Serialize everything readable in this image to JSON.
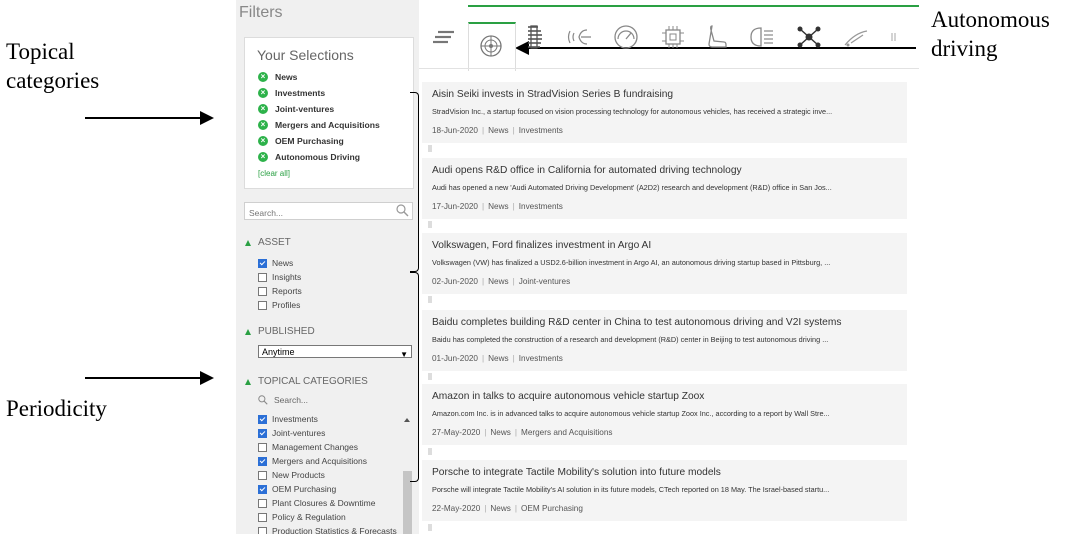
{
  "annotations": {
    "topical": "Topical\ncategories",
    "periodicity": "Periodicity",
    "autonomous": "Autonomous\ndriving"
  },
  "panel": {
    "title": "Filters",
    "your_selections": "Your Selections",
    "selections": [
      "News",
      "Investments",
      "Joint-ventures",
      "Mergers and Acquisitions",
      "OEM Purchasing",
      "Autonomous Driving"
    ],
    "clear_all": "[clear all]",
    "search_placeholder": "Search...",
    "asset": {
      "heading": "ASSET",
      "options": [
        {
          "label": "News",
          "checked": true
        },
        {
          "label": "Insights",
          "checked": false
        },
        {
          "label": "Reports",
          "checked": false
        },
        {
          "label": "Profiles",
          "checked": false
        }
      ]
    },
    "published": {
      "heading": "PUBLISHED",
      "selected": "Anytime"
    },
    "topical": {
      "heading": "TOPICAL CATEGORIES",
      "search_placeholder": "Search...",
      "options": [
        {
          "label": "Investments",
          "checked": true
        },
        {
          "label": "Joint-ventures",
          "checked": true
        },
        {
          "label": "Management Changes",
          "checked": false
        },
        {
          "label": "Mergers and Acquisitions",
          "checked": true
        },
        {
          "label": "New Products",
          "checked": false
        },
        {
          "label": "OEM Purchasing",
          "checked": true
        },
        {
          "label": "Plant Closures & Downtime",
          "checked": false
        },
        {
          "label": "Policy & Regulation",
          "checked": false
        },
        {
          "label": "Production Statistics & Forecasts",
          "checked": false
        }
      ]
    }
  },
  "toolbar": {
    "icons": [
      "menu-lines-icon",
      "autonomous-target-icon",
      "battery-grid-icon",
      "connectivity-wave-icon",
      "speedometer-icon",
      "chip-icon",
      "seat-icon",
      "headlight-icon",
      "network-nodes-icon",
      "wiper-icon"
    ],
    "accent": "#2aa043"
  },
  "articles": [
    {
      "title": "Aisin Seiki invests in StradVision Series B fundraising",
      "desc": "StradVision Inc., a startup focused on vision processing technology for autonomous vehicles, has received a strategic inve...",
      "date": "18-Jun-2020",
      "tags": [
        "News",
        "Investments"
      ]
    },
    {
      "title": "Audi opens R&D office in California for automated driving technology",
      "desc": "Audi has opened a new 'Audi Automated Driving Development' (A2D2) research and development (R&D) office in San Jos...",
      "date": "17-Jun-2020",
      "tags": [
        "News",
        "Investments"
      ]
    },
    {
      "title": "Volkswagen, Ford finalizes investment in Argo AI",
      "desc": "Volkswagen (VW) has finalized a USD2.6-billion investment in Argo AI, an autonomous driving startup based in Pittsburg, ...",
      "date": "02-Jun-2020",
      "tags": [
        "News",
        "Joint-ventures"
      ]
    },
    {
      "title": "Baidu completes building R&D center in China to test autonomous driving and V2I systems",
      "desc": "Baidu has completed the construction of a research and development (R&D) center in Beijing to test autonomous driving ...",
      "date": "01-Jun-2020",
      "tags": [
        "News",
        "Investments"
      ]
    },
    {
      "title": "Amazon in talks to acquire autonomous vehicle startup Zoox",
      "desc": "Amazon.com Inc. is in advanced talks to acquire autonomous vehicle startup Zoox Inc., according to a report by Wall Stre...",
      "date": "27-May-2020",
      "tags": [
        "News",
        "Mergers and Acquisitions"
      ]
    },
    {
      "title": "Porsche to integrate Tactile Mobility's solution into future models",
      "desc": "Porsche will integrate Tactile Mobility's AI solution in its future models, CTech reported on 18 May. The Israel-based startu...",
      "date": "22-May-2020",
      "tags": [
        "News",
        "OEM Purchasing"
      ]
    }
  ]
}
